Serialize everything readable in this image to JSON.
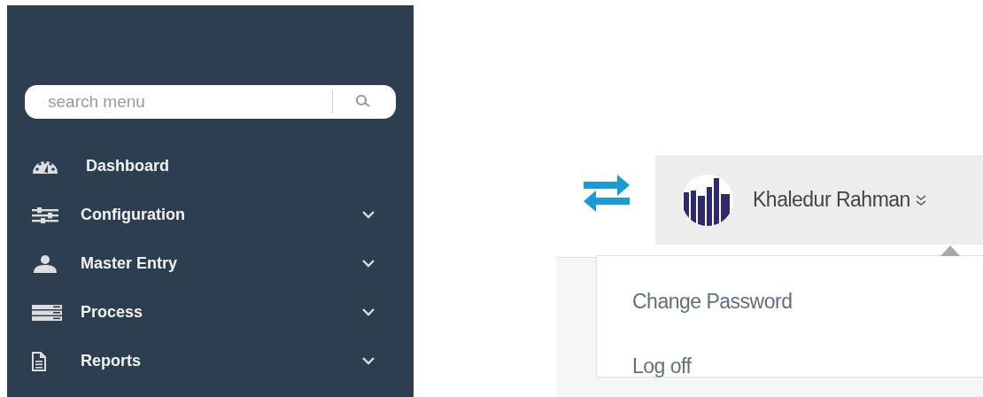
{
  "sidebar": {
    "search": {
      "placeholder": "search menu"
    },
    "items": [
      {
        "label": "Dashboard",
        "expandable": false
      },
      {
        "label": "Configuration",
        "expandable": true
      },
      {
        "label": "Master Entry",
        "expandable": true
      },
      {
        "label": "Process",
        "expandable": true
      },
      {
        "label": "Reports",
        "expandable": true
      }
    ]
  },
  "user_menu": {
    "name": "Khaledur Rahman",
    "expanded": true,
    "items": [
      {
        "label": "Change Password"
      },
      {
        "label": "Log off"
      }
    ]
  }
}
